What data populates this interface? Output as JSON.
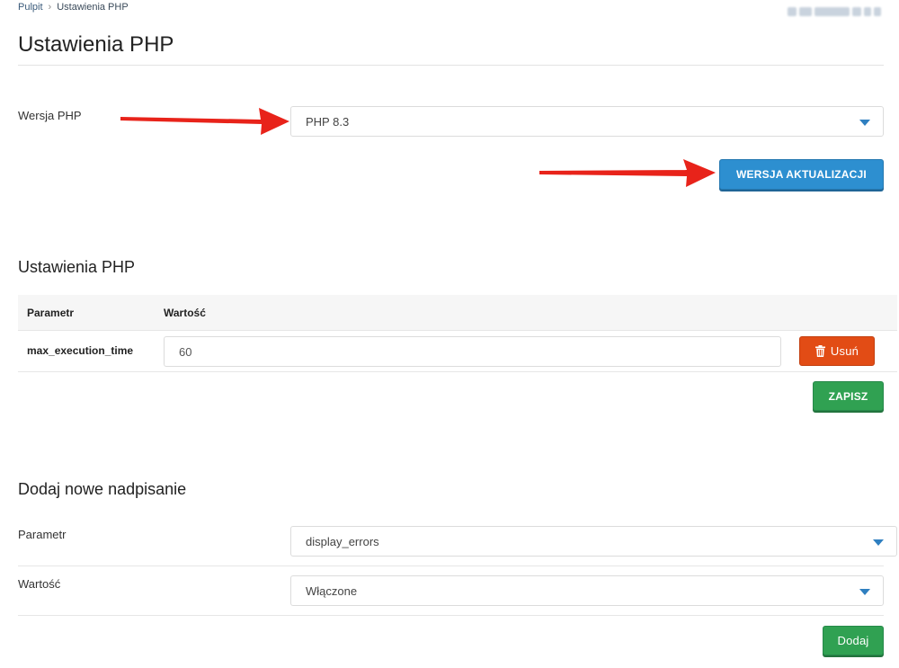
{
  "breadcrumb": {
    "home": "Pulpit",
    "current": "Ustawienia PHP"
  },
  "page": {
    "title": "Ustawienia PHP"
  },
  "php_version": {
    "label": "Wersja PHP",
    "selected": "PHP 8.3",
    "update_button": "WERSJA AKTUALIZACJI"
  },
  "settings": {
    "title": "Ustawienia PHP",
    "columns": {
      "param": "Parametr",
      "value": "Wartość"
    },
    "rows": [
      {
        "param": "max_execution_time",
        "value": "60",
        "delete_label": "Usuń"
      }
    ],
    "save_button": "ZAPISZ"
  },
  "new_override": {
    "title": "Dodaj nowe nadpisanie",
    "param_label": "Parametr",
    "param_selected": "display_errors",
    "value_label": "Wartość",
    "value_selected": "Włączone",
    "add_button": "Dodaj"
  },
  "colors": {
    "primary_blue": "#2d8fd0",
    "success_green": "#30a152",
    "danger_orange": "#e24c15",
    "annotation_arrow": "#e8231a"
  },
  "icons": {
    "delete": "trash-icon",
    "dropdown": "caret-down-icon",
    "breadcrumb_sep": "chevron-right-icon"
  }
}
